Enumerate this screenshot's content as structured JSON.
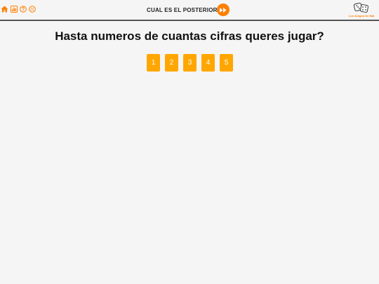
{
  "header": {
    "title": "CUAL ES EL POSTERIOR?",
    "brand": "Los Juegos De Mat",
    "icons": [
      "home-icon",
      "stats-icon",
      "help-icon",
      "fullscreen-icon",
      "play-forward-icon"
    ]
  },
  "main": {
    "question": "Hasta numeros de cuantas cifras queres jugar?",
    "options": [
      "1",
      "2",
      "3",
      "4",
      "5"
    ]
  },
  "colors": {
    "accent": "#ff7f00",
    "option_bg": "#ffa700",
    "background": "#f5f5f5",
    "divider": "#555555"
  }
}
